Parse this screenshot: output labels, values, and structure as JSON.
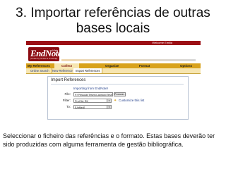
{
  "slide": {
    "title": "3. Importar referências de outras bases locais",
    "caption": "Seleccionar o ficheiro das referências e o formato. Estas bases deverão ter sido produzidas com alguma ferramenta de gestão bibliográfica."
  },
  "app": {
    "topbar_welcome": "Welcome Emilia",
    "logo_text": "EndNote",
    "logo_superscript": "Web",
    "logo_sub": "provided by ISI Web of Knowledge"
  },
  "nav": {
    "tabs": [
      {
        "label": "My References"
      },
      {
        "label": "Collect"
      },
      {
        "label": "Organize"
      },
      {
        "label": "Format"
      },
      {
        "label": "Options"
      }
    ],
    "subtabs": [
      {
        "label": "Online Search"
      },
      {
        "label": "New Reference"
      },
      {
        "label": "Import References"
      }
    ]
  },
  "import_panel": {
    "title": "Import References",
    "importing_line": "Importing from EndNote!",
    "file_label": "File:",
    "file_value": "F:\\Pessoal\\Teses\\Capitulo\\Teses\\Bibliog",
    "browse_label": "Procurar...",
    "filter_label": "Filter:",
    "filter_value": "ProCite Rtf",
    "customize_link": "Customize this list",
    "to_label": "To:",
    "to_value": "[Unfiled]"
  },
  "colors": {
    "topbar": "#9c0f15",
    "nav": "#d8a21c",
    "subnav": "#f6e5b0",
    "link": "#1f3d8a"
  }
}
